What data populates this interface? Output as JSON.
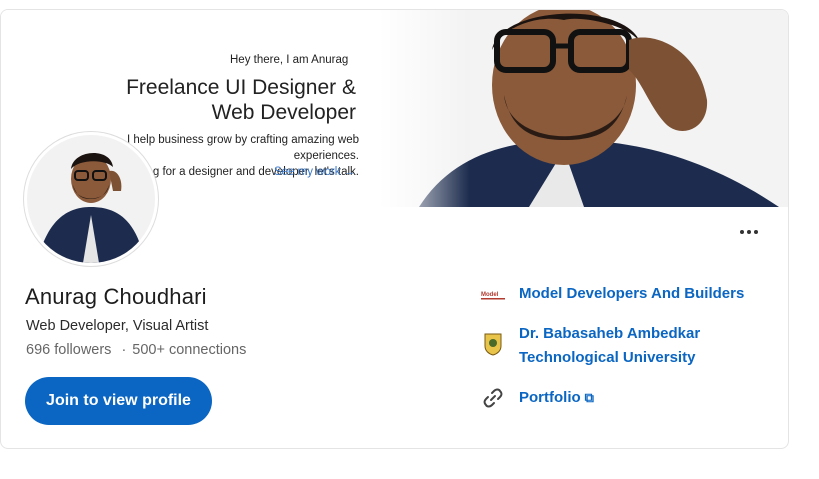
{
  "banner": {
    "greeting": "Hey  there, I am Anurag",
    "headline": "Freelance UI Designer &\nWeb Developer",
    "body": "I help business grow by crafting amazing web experiences.\nIf you're looking for a designer and developer, let's talk.",
    "link_label": "See my work →"
  },
  "profile": {
    "name": "Anurag Choudhari",
    "headline": "Web Developer, Visual Artist",
    "followers": "696 followers",
    "separator": "·",
    "connections": "500+ connections",
    "join_label": "Join to view profile"
  },
  "sidebar": {
    "company": "Model Developers And Builders",
    "education_line1": "Dr. Babasaheb Ambedkar",
    "education_line2": "Technological University",
    "portfolio": "Portfolio",
    "external_glyph": "⧉"
  },
  "colors": {
    "brand": "#0a66c2",
    "banner_link": "#3a78c9"
  },
  "icons": {
    "more": "more-horizontal-icon",
    "company": "company-logo-icon",
    "education": "university-seal-icon",
    "portfolio": "link-icon"
  }
}
